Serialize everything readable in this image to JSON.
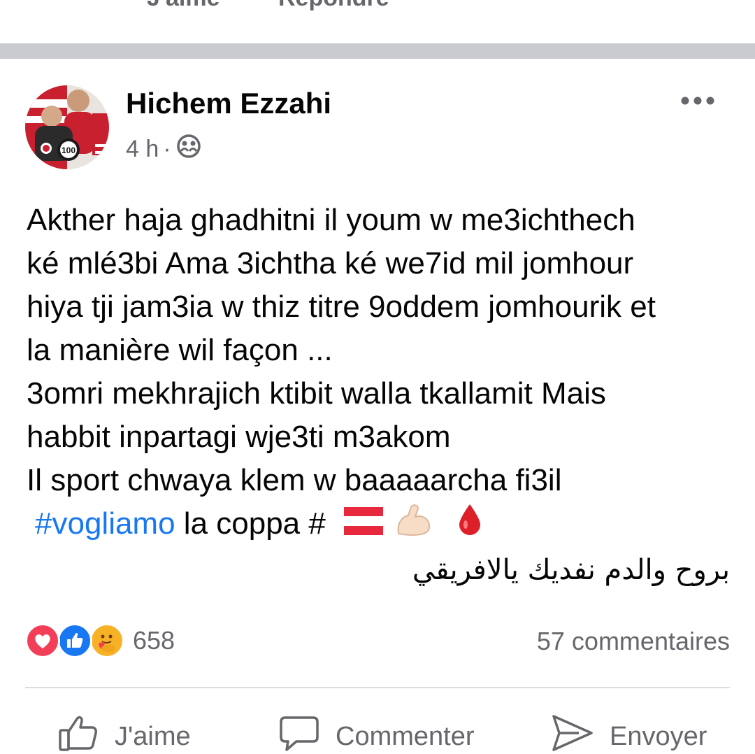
{
  "previous_comment": {
    "like_label": "J'aime",
    "reply_label": "Répondre"
  },
  "post": {
    "author": "Hichem Ezzahi",
    "time": "4 h",
    "separator": "·",
    "audience_icon": "friends-icon",
    "more_icon": "more-horizontal-icon",
    "text_lines": [
      "Akther haja ghadhitni il youm w me3ichthech",
      "ké mlé3bi Ama 3ichtha ké we7id mil jomhour",
      "hiya tji jam3ia w thiz titre 9oddem jomhourik et",
      "la manière wil façon ...",
      "3omri mekhrajich ktibit walla tkallamit Mais",
      "habbit inpartagi wje3ti m3akom",
      "Il sport chwaya klem w baaaaarcha fi3il"
    ],
    "hashtag": "#vogliamo",
    "hashtag_rest": "la coppa #",
    "arabic_line": "بروح والدم نفديك يالافريقي"
  },
  "engagement": {
    "reaction_icons": [
      "love-reaction-icon",
      "like-reaction-icon",
      "care-reaction-icon"
    ],
    "reaction_count": "658",
    "comments_label": "57 commentaires"
  },
  "actions": {
    "like_label": "J'aime",
    "comment_label": "Commenter",
    "send_label": "Envoyer"
  },
  "colors": {
    "hashtag": "#1877f2",
    "secondary_text": "#65676b",
    "separator": "#c9cbce",
    "love": "#f33e58",
    "like": "#1877f2",
    "care": "#f7b125"
  }
}
